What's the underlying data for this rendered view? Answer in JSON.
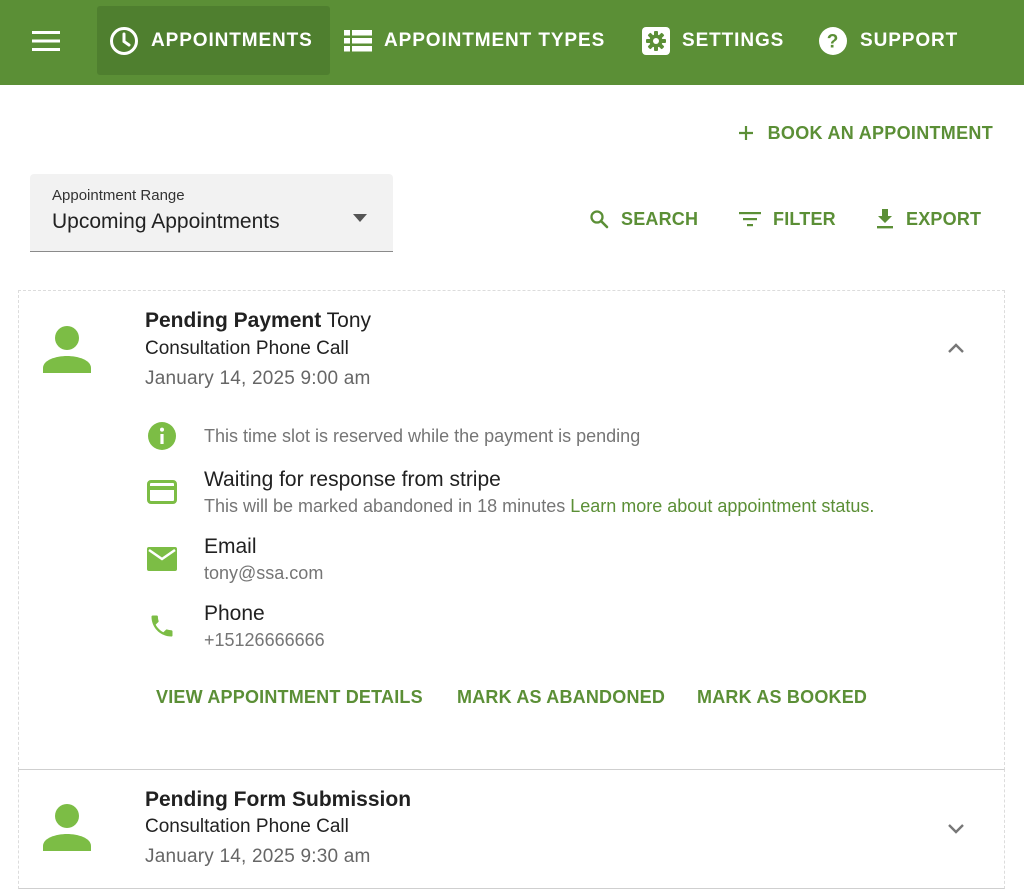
{
  "colors": {
    "nav_bg": "#5b8f36",
    "nav_active_bg": "#4f7f2f",
    "accent": "#5b8f36",
    "icon_green": "#7cbd45"
  },
  "nav": {
    "menu_icon": "hamburger-icon",
    "tabs": [
      {
        "label": "APPOINTMENTS",
        "icon": "clock-icon",
        "active": true
      },
      {
        "label": "APPOINTMENT TYPES",
        "icon": "list-icon",
        "active": false
      },
      {
        "label": "SETTINGS",
        "icon": "gear-icon",
        "active": false
      },
      {
        "label": "SUPPORT",
        "icon": "help-icon",
        "active": false
      }
    ]
  },
  "book_button": {
    "label": "BOOK AN APPOINTMENT",
    "icon": "plus-icon"
  },
  "range_select": {
    "label": "Appointment Range",
    "value": "Upcoming Appointments",
    "icon": "caret-down-icon"
  },
  "tools": [
    {
      "label": "SEARCH",
      "icon": "search-icon"
    },
    {
      "label": "FILTER",
      "icon": "filter-icon"
    },
    {
      "label": "EXPORT",
      "icon": "download-icon"
    }
  ],
  "appointments": [
    {
      "status": "Pending Payment",
      "name": "Tony",
      "service": "Consultation Phone Call",
      "datetime": "January 14, 2025 9:00 am",
      "expanded": true,
      "info_note": "This time slot is reserved while the payment is pending",
      "payment": {
        "title": "Waiting for response from stripe",
        "subtitle": "This will be marked abandoned in 18 minutes",
        "link": "Learn more about appointment status."
      },
      "email": {
        "label": "Email",
        "value": "tony@ssa.com"
      },
      "phone": {
        "label": "Phone",
        "value": "+15126666666"
      },
      "actions": [
        "VIEW APPOINTMENT DETAILS",
        "MARK AS ABANDONED",
        "MARK AS BOOKED"
      ]
    },
    {
      "status": "Pending Form Submission",
      "name": "",
      "service": "Consultation Phone Call",
      "datetime": "January 14, 2025 9:30 am",
      "expanded": false
    }
  ]
}
